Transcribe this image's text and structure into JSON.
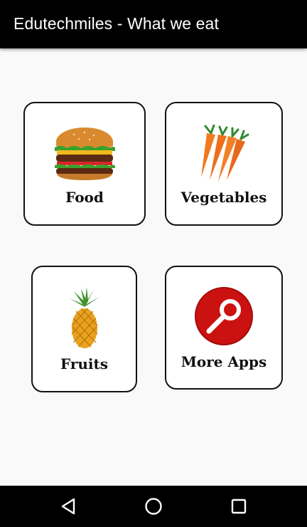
{
  "app": {
    "title": "Edutechmiles - What we eat"
  },
  "tiles": [
    {
      "id": "food",
      "label": "Food",
      "icon": "burger-icon"
    },
    {
      "id": "vegetables",
      "label": "Vegetables",
      "icon": "carrots-icon"
    },
    {
      "id": "fruits",
      "label": "Fruits",
      "icon": "pineapple-icon"
    },
    {
      "id": "more_apps",
      "label": "More Apps",
      "icon": "search-key-icon",
      "accent": "#cc1111"
    }
  ],
  "navbar": {
    "buttons": [
      {
        "name": "back",
        "icon": "back-triangle-icon"
      },
      {
        "name": "home",
        "icon": "home-circle-icon"
      },
      {
        "name": "recents",
        "icon": "recents-square-icon"
      }
    ]
  }
}
